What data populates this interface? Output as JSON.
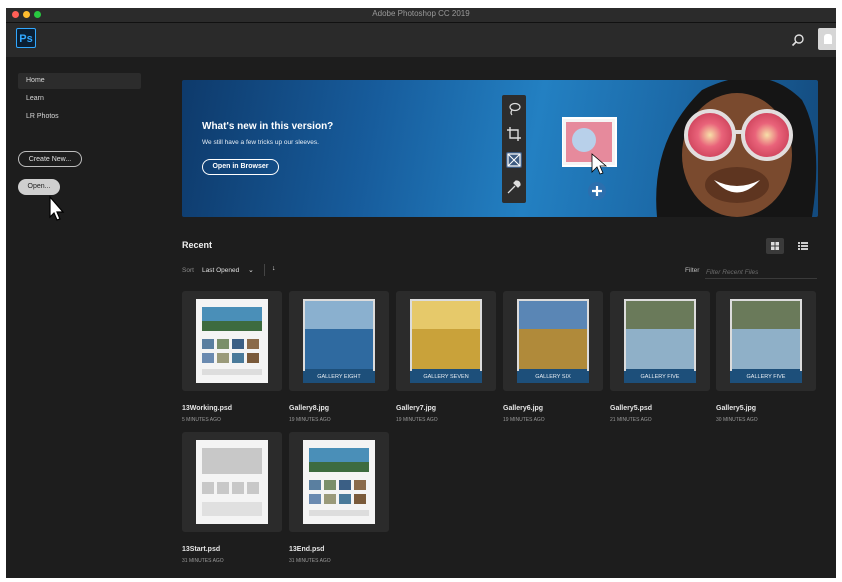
{
  "window": {
    "title": "Adobe Photoshop CC 2019"
  },
  "app": {
    "logo": "Ps",
    "search_icon": "search-icon",
    "avatar_icon": "user-avatar-icon"
  },
  "sidebar": {
    "items": [
      {
        "label": "Home"
      },
      {
        "label": "Learn"
      },
      {
        "label": "LR Photos"
      }
    ],
    "create_new": "Create New...",
    "open": "Open..."
  },
  "banner": {
    "heading": "What's new in this version?",
    "subheading": "We still have a few tricks up our sleeves.",
    "button": "Open in Browser",
    "tools": [
      "lasso-icon",
      "crop-icon",
      "frame-icon",
      "eyedropper-icon"
    ]
  },
  "recent": {
    "heading": "Recent",
    "sort_label": "Sort",
    "sort_value": "Last Opened",
    "filter_label": "Filter",
    "filter_placeholder": "Filter Recent Files",
    "files": [
      {
        "name": "13Working.psd",
        "time": "5 MINUTES AGO",
        "thumb": "document"
      },
      {
        "name": "Gallery8.jpg",
        "time": "19 MINUTES AGO",
        "thumb": "gallery",
        "label": "GALLERY EIGHT"
      },
      {
        "name": "Gallery7.jpg",
        "time": "19 MINUTES AGO",
        "thumb": "gallery",
        "label": "GALLERY SEVEN"
      },
      {
        "name": "Gallery6.jpg",
        "time": "19 MINUTES AGO",
        "thumb": "gallery",
        "label": "GALLERY SIX"
      },
      {
        "name": "Gallery5.psd",
        "time": "21 MINUTES AGO",
        "thumb": "gallery",
        "label": "GALLERY FIVE"
      },
      {
        "name": "Gallery5.jpg",
        "time": "30 MINUTES AGO",
        "thumb": "gallery",
        "label": "GALLERY FIVE"
      },
      {
        "name": "13Start.psd",
        "time": "31 MINUTES AGO",
        "thumb": "wireframe"
      },
      {
        "name": "13End.psd",
        "time": "31 MINUTES AGO",
        "thumb": "document"
      }
    ]
  },
  "colors": {
    "accent": "#31a8ff",
    "background": "#1d1d1d",
    "panel": "#2b2b2b",
    "label_bar": "#1d4f7a"
  }
}
